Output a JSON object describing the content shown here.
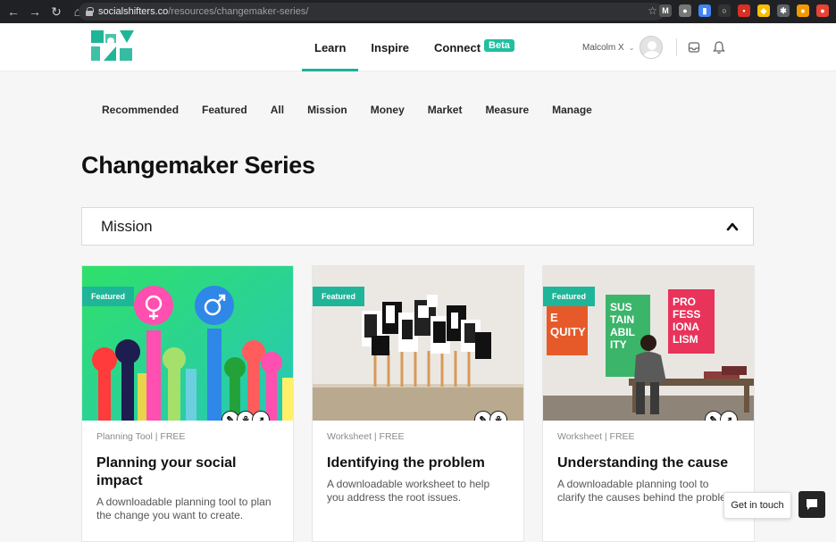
{
  "browser": {
    "url_domain": "socialshifters.co",
    "url_path": "/resources/changemaker-series/",
    "extensions": [
      {
        "name": "gmail-icon",
        "color": "#555555",
        "glyph": "M"
      },
      {
        "name": "circle-ext-icon",
        "color": "#777777",
        "glyph": "●"
      },
      {
        "name": "doc-ext-icon",
        "color": "#4285f4",
        "glyph": "▮"
      },
      {
        "name": "grey-ext-icon",
        "color": "#333333",
        "glyph": "○"
      },
      {
        "name": "red-ext-icon",
        "color": "#d93025",
        "glyph": "▪"
      },
      {
        "name": "chrome-color-icon",
        "color": "#fbbc04",
        "glyph": "◆"
      },
      {
        "name": "puzzle-icon",
        "color": "#5f6368",
        "glyph": "✱"
      },
      {
        "name": "profile-ext-icon",
        "color": "#f29900",
        "glyph": "●"
      },
      {
        "name": "record-ext-icon",
        "color": "#ea4335",
        "glyph": "●"
      }
    ]
  },
  "header": {
    "nav": [
      {
        "label": "Learn",
        "active": true
      },
      {
        "label": "Inspire",
        "active": false
      },
      {
        "label": "Connect",
        "active": false,
        "badge": "Beta"
      }
    ],
    "user_name": "Malcolm X",
    "caret": "⌄"
  },
  "sub_nav": [
    "Recommended",
    "Featured",
    "All",
    "Mission",
    "Money",
    "Market",
    "Measure",
    "Manage"
  ],
  "page_title": "Changemaker Series",
  "accordion": {
    "label": "Mission"
  },
  "cards": [
    {
      "tag": "Featured",
      "meta": "Planning Tool | FREE",
      "title": "Planning your social impact",
      "desc": "A downloadable planning tool to plan the change you want to create.",
      "icons": [
        "pencil",
        "sprout",
        "rocket"
      ]
    },
    {
      "tag": "Featured",
      "meta": "Worksheet | FREE",
      "title": "Identifying the problem",
      "desc": "A downloadable worksheet to help you address the root issues.",
      "icons": [
        "pencil",
        "sprout"
      ]
    },
    {
      "tag": "Featured",
      "meta": "Worksheet | FREE",
      "title": "Understanding the cause",
      "desc": "A downloadable planning tool to clarify the causes behind the problem.",
      "icons": [
        "pencil",
        "rocket"
      ]
    }
  ],
  "poster_words": {
    "equity": "E\nQUITY",
    "sustainability": "SUS\nTAIN\nABIL\nITY",
    "professionalism": "PRO\nFESS\nIONA\nLISM"
  },
  "floating": {
    "get_in_touch": "Get in touch"
  }
}
